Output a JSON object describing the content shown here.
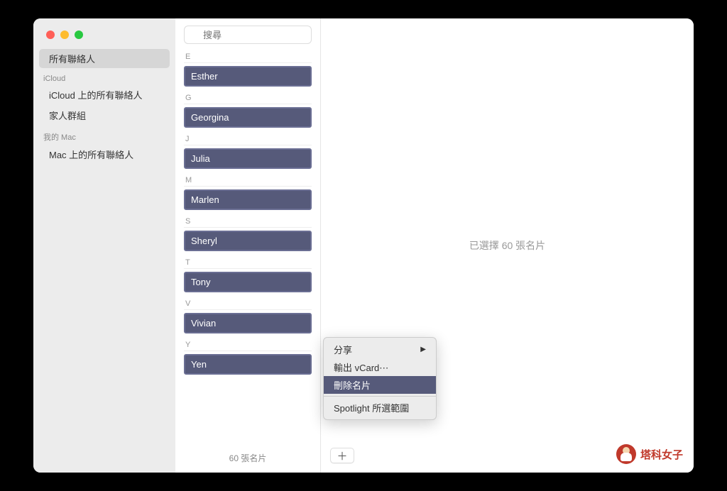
{
  "sidebar": {
    "all_contacts": "所有聯絡人",
    "sections": [
      {
        "header": "iCloud",
        "items": [
          "iCloud 上的所有聯絡人",
          "家人群組"
        ]
      },
      {
        "header": "我的 Mac",
        "items": [
          "Mac 上的所有聯絡人"
        ]
      }
    ]
  },
  "search": {
    "placeholder": "搜尋"
  },
  "contacts": [
    {
      "letter": "E",
      "name": "Esther"
    },
    {
      "letter": "G",
      "name": "Georgina"
    },
    {
      "letter": "J",
      "name": "Julia"
    },
    {
      "letter": "M",
      "name": "Marlen"
    },
    {
      "letter": "S",
      "name": "Sheryl"
    },
    {
      "letter": "T",
      "name": "Tony"
    },
    {
      "letter": "V",
      "name": "Vivian"
    },
    {
      "letter": "Y",
      "name": "Yen"
    }
  ],
  "list_footer": "60 張名片",
  "detail_text": "已選擇 60 張名片",
  "context_menu": {
    "share": "分享",
    "export": "輸出 vCard⋯",
    "delete": "刪除名片",
    "spotlight": "Spotlight 所選範圍"
  },
  "add_button": "＋",
  "watermark": "塔科女子"
}
